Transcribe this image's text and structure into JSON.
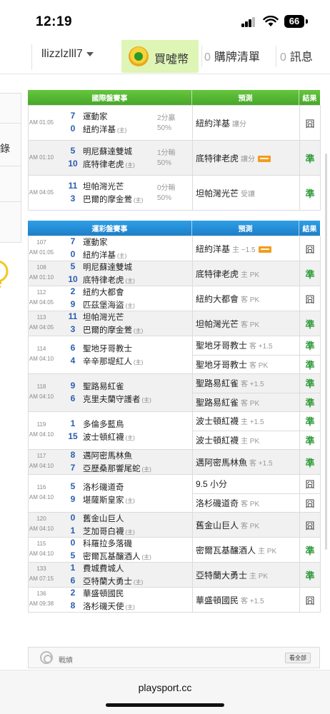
{
  "status": {
    "time": "12:19",
    "battery": "66"
  },
  "nav": {
    "username": "llizzlzlll7",
    "buy_label": "買噓幣",
    "cart_count": "0",
    "cart_label": "購牌清單",
    "msg_count": "0",
    "msg_label": "訊息"
  },
  "side": {
    "text": "錄"
  },
  "intl": {
    "header": {
      "match": "國際盤賽事",
      "pred": "預測",
      "result": "結果"
    },
    "rows": [
      {
        "time": "AM 01:05",
        "s1": "7",
        "t1": "運動家",
        "s2": "0",
        "t2": "紐約洋基",
        "rate1": "2分贏",
        "rate2": "50%",
        "pred_team": "紐約洋基",
        "pred_side": "讓分",
        "tag": false,
        "result": "囧",
        "win": false
      },
      {
        "time": "AM 01:10",
        "s1": "5",
        "t1": "明尼蘇達雙城",
        "s2": "10",
        "t2": "底特律老虎",
        "rate1": "1分輸",
        "rate2": "50%",
        "pred_team": "底特律老虎",
        "pred_side": "讓分",
        "tag": true,
        "result": "準",
        "win": true
      },
      {
        "time": "AM 04:05",
        "s1": "11",
        "t1": "坦帕灣光芒",
        "s2": "3",
        "t2": "巴爾的摩金鶯",
        "rate1": "0分輸",
        "rate2": "50%",
        "pred_team": "坦帕灣光芒",
        "pred_side": "受讓",
        "tag": false,
        "result": "準",
        "win": true
      }
    ]
  },
  "lottery": {
    "header": {
      "match": "運彩盤賽事",
      "pred": "預測",
      "result": "結果"
    },
    "home_mark": "(主)",
    "rows": [
      {
        "num": "107",
        "time": "AM 01:05",
        "s1": "7",
        "t1": "運動家",
        "s2": "0",
        "t2": "紐約洋基",
        "preds": [
          {
            "team": "紐約洋基",
            "side": "主 −1.5",
            "tag": true,
            "result": "囧",
            "win": false
          }
        ]
      },
      {
        "num": "108",
        "time": "AM 01:10",
        "s1": "5",
        "t1": "明尼蘇達雙城",
        "s2": "10",
        "t2": "底特律老虎",
        "preds": [
          {
            "team": "底特律老虎",
            "side": "主 PK",
            "tag": false,
            "result": "準",
            "win": true
          }
        ]
      },
      {
        "num": "112",
        "time": "AM 04:05",
        "s1": "2",
        "t1": "紐約大都會",
        "s2": "9",
        "t2": "匹茲堡海盜",
        "preds": [
          {
            "team": "紐約大都會",
            "side": "客 PK",
            "tag": false,
            "result": "囧",
            "win": false
          }
        ]
      },
      {
        "num": "113",
        "time": "AM 04:05",
        "s1": "11",
        "t1": "坦帕灣光芒",
        "s2": "3",
        "t2": "巴爾的摩金鶯",
        "preds": [
          {
            "team": "坦帕灣光芒",
            "side": "客 PK",
            "tag": false,
            "result": "準",
            "win": true
          }
        ]
      },
      {
        "num": "114",
        "time": "AM 04:10",
        "s1": "6",
        "t1": "聖地牙哥教士",
        "s2": "4",
        "t2": "辛辛那堤紅人",
        "preds": [
          {
            "team": "聖地牙哥教士",
            "side": "客 +1.5",
            "tag": false,
            "result": "準",
            "win": true
          },
          {
            "team": "聖地牙哥教士",
            "side": "客 PK",
            "tag": false,
            "result": "準",
            "win": true
          }
        ]
      },
      {
        "num": "118",
        "time": "AM 04:10",
        "s1": "9",
        "t1": "聖路易紅雀",
        "s2": "6",
        "t2": "克里夫蘭守護者",
        "preds": [
          {
            "team": "聖路易紅雀",
            "side": "客 +1.5",
            "tag": false,
            "result": "準",
            "win": true
          },
          {
            "team": "聖路易紅雀",
            "side": "客 PK",
            "tag": false,
            "result": "準",
            "win": true
          }
        ]
      },
      {
        "num": "119",
        "time": "AM 04:10",
        "s1": "1",
        "t1": "多倫多藍鳥",
        "s2": "15",
        "t2": "波士頓紅襪",
        "preds": [
          {
            "team": "波士頓紅襪",
            "side": "主 +1.5",
            "tag": false,
            "result": "準",
            "win": true
          },
          {
            "team": "波士頓紅襪",
            "side": "主 PK",
            "tag": false,
            "result": "準",
            "win": true
          }
        ]
      },
      {
        "num": "117",
        "time": "AM 04:10",
        "s1": "8",
        "t1": "邁阿密馬林魚",
        "s2": "7",
        "t2": "亞歷桑那響尾蛇",
        "preds": [
          {
            "team": "邁阿密馬林魚",
            "side": "客 +1.5",
            "tag": false,
            "result": "準",
            "win": true
          }
        ]
      },
      {
        "num": "116",
        "time": "AM 04:10",
        "s1": "5",
        "t1": "洛杉磯道奇",
        "s2": "9",
        "t2": "堪薩斯皇家",
        "preds": [
          {
            "team": "9.5 小分",
            "side": "",
            "tag": false,
            "result": "囧",
            "win": false
          },
          {
            "team": "洛杉磯道奇",
            "side": "客 PK",
            "tag": false,
            "result": "囧",
            "win": false
          }
        ]
      },
      {
        "num": "120",
        "time": "AM 04:10",
        "s1": "0",
        "t1": "舊金山巨人",
        "s2": "1",
        "t2": "芝加哥白襪",
        "preds": [
          {
            "team": "舊金山巨人",
            "side": "客 PK",
            "tag": false,
            "result": "囧",
            "win": false
          }
        ]
      },
      {
        "num": "115",
        "time": "AM 04:10",
        "s1": "0",
        "t1": "科羅拉多落磯",
        "s2": "5",
        "t2": "密爾瓦基釀酒人",
        "preds": [
          {
            "team": "密爾瓦基釀酒人",
            "side": "主 PK",
            "tag": false,
            "result": "準",
            "win": true
          }
        ]
      },
      {
        "num": "133",
        "time": "AM 07:15",
        "s1": "1",
        "t1": "費城費城人",
        "s2": "6",
        "t2": "亞特蘭大勇士",
        "preds": [
          {
            "team": "亞特蘭大勇士",
            "side": "主 PK",
            "tag": false,
            "result": "準",
            "win": true
          }
        ]
      },
      {
        "num": "136",
        "time": "AM 09:38",
        "s1": "2",
        "t1": "華盛頓國民",
        "s2": "8",
        "t2": "洛杉磯天使",
        "preds": [
          {
            "team": "華盛頓國民",
            "side": "客 +1.5",
            "tag": false,
            "result": "囧",
            "win": false
          }
        ]
      }
    ]
  },
  "footer": {
    "label": "戰績",
    "button": "看全部"
  },
  "browser": {
    "url": "playsport.cc"
  },
  "colors": {
    "win": "#2e9b3a",
    "score": "#2a5db0",
    "intl_header": "#47a72a",
    "lottery_header": "#1d7fc8",
    "buy_bg": "#def5b6"
  }
}
